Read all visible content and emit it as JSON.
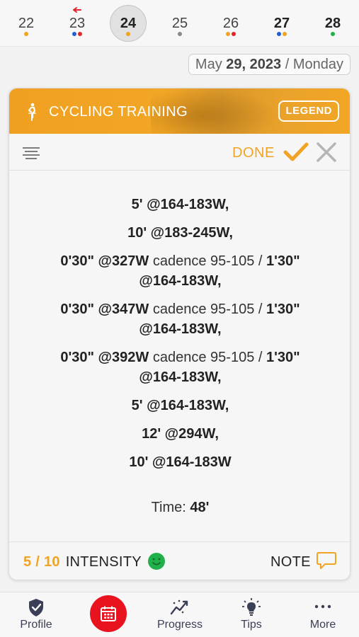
{
  "week_strip": {
    "days": [
      {
        "num": "22",
        "bold": false,
        "selected": false,
        "dots": [
          "#f1a323"
        ]
      },
      {
        "num": "23",
        "bold": false,
        "selected": false,
        "dots": [
          "#1f5fd6",
          "#e0262c"
        ],
        "arrow": true
      },
      {
        "num": "24",
        "bold": true,
        "selected": true,
        "dots": [
          "#f1a323"
        ]
      },
      {
        "num": "25",
        "bold": false,
        "selected": false,
        "dots": [
          "#8a8a8a"
        ]
      },
      {
        "num": "26",
        "bold": false,
        "selected": false,
        "dots": [
          "#f1a323",
          "#e0262c"
        ]
      },
      {
        "num": "27",
        "bold": true,
        "selected": false,
        "dots": [
          "#1f5fd6",
          "#f1a323"
        ]
      },
      {
        "num": "28",
        "bold": true,
        "selected": false,
        "dots": [
          "#22b04a"
        ]
      }
    ]
  },
  "date_chip": {
    "month": "May",
    "day": "29,",
    "year": "2023",
    "sep": "/",
    "weekday": "Monday"
  },
  "card": {
    "title": "CYCLING TRAINING",
    "legend_label": "LEGEND",
    "done_label": "DONE",
    "steps": [
      {
        "b1": "5' @164-183W,"
      },
      {
        "b1": "10' @183-245W,"
      },
      {
        "b1": "0'30\" @327W",
        "n": " cadence 95-105 / ",
        "b2": "1'30\"",
        "line2": "@164-183W,"
      },
      {
        "b1": "0'30\" @347W",
        "n": " cadence 95-105 / ",
        "b2": "1'30\"",
        "line2": "@164-183W,"
      },
      {
        "b1": "0'30\" @392W",
        "n": " cadence 95-105 / ",
        "b2": "1'30\"",
        "line2": "@164-183W,"
      },
      {
        "b1": "5' @164-183W,"
      },
      {
        "b1": "12' @294W,"
      },
      {
        "b1": "10' @164-183W"
      }
    ],
    "time_label": "Time:",
    "time_value": "48'",
    "intensity_score": "5 / 10",
    "intensity_label": "INTENSITY",
    "note_label": "NOTE"
  },
  "tabbar": {
    "profile": "Profile",
    "progress": "Progress",
    "tips": "Tips",
    "more": "More"
  },
  "colors": {
    "accent": "#f1a323",
    "calendar_button": "#e8131f",
    "intensity_face": "#22b04a",
    "tab_icon": "#3a3f55"
  }
}
